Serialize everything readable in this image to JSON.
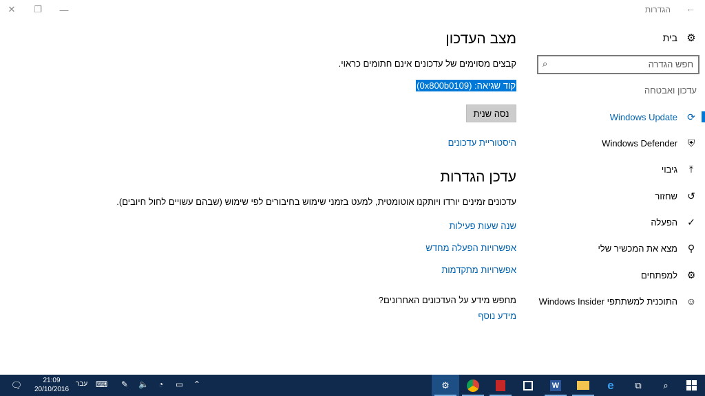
{
  "window": {
    "title": "הגדרות",
    "back_glyph": "←",
    "close_glyph": "✕",
    "restore_glyph": "❐",
    "minimize_glyph": "—"
  },
  "nav": {
    "home_label": "בית",
    "search_placeholder": "חפש הגדרה",
    "section_title": "עדכון ואבטחה",
    "items": [
      {
        "label": "Windows Update",
        "icon": "refresh-icon",
        "glyph": "⟳"
      },
      {
        "label": "Windows Defender",
        "icon": "shield-icon",
        "glyph": "⛨"
      },
      {
        "label": "גיבוי",
        "icon": "backup-arrow-icon",
        "glyph": "⤒"
      },
      {
        "label": "שחזור",
        "icon": "history-icon",
        "glyph": "↺"
      },
      {
        "label": "הפעלה",
        "icon": "check-circle-icon",
        "glyph": "✓"
      },
      {
        "label": "מצא את המכשיר שלי",
        "icon": "person-location-icon",
        "glyph": "⚲"
      },
      {
        "label": "למפתחים",
        "icon": "developer-tools-icon",
        "glyph": "⚙"
      },
      {
        "label": "התוכנית למשתתפי Windows Insider",
        "icon": "insider-person-icon",
        "glyph": "☺"
      }
    ],
    "active_index": 0,
    "accent_color": "#0078d7"
  },
  "main": {
    "status_title": "מצב העדכון",
    "status_message": "קבצים מסוימים של עדכונים אינם חתומים כראוי.",
    "error_code": "קוד שגיאה: (0x800b0109)",
    "retry_label": "נסה שנית",
    "history_link": "היסטוריית עדכונים",
    "settings_title": "עדכן הגדרות",
    "settings_message": "עדכונים זמינים יורדו ויותקנו אוטומטית, למעט בזמני שימוש בחיבורים לפי שימוש (שבהם עשויים לחול חיובים).",
    "active_hours_link": "שנה שעות פעילות",
    "restart_options_link": "אפשרויות הפעלה מחדש",
    "advanced_options_link": "אפשרויות מתקדמות",
    "info_question": "מחפש מידע על העדכונים האחרונים?",
    "more_info_link": "מידע נוסף"
  },
  "taskbar": {
    "time": "21:09",
    "date": "20/10/2016",
    "language": "עבר",
    "bg_color": "#0f2a4c"
  }
}
